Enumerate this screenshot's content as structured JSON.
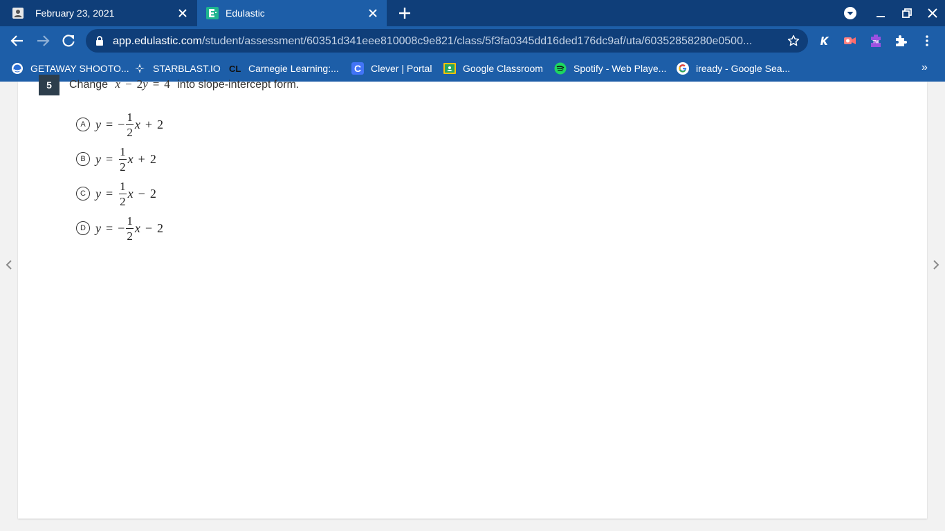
{
  "tabs": [
    {
      "title": "February 23, 2021",
      "active": false,
      "icon": "contacts-icon"
    },
    {
      "title": "Edulastic",
      "active": true,
      "icon": "edulastic-logo-icon"
    }
  ],
  "address_bar": {
    "host": "app.edulastic.com",
    "path": "/student/assessment/60351d341eee810008c9e821/class/5f3fa0345dd16ded176dc9af/uta/60352858280e0500..."
  },
  "bookmarks": [
    {
      "label": "GETAWAY SHOOTO...",
      "icon": "globe-icon"
    },
    {
      "label": "STARBLAST.IO",
      "icon": "starblast-icon"
    },
    {
      "label": "Carnegie Learning:...",
      "icon": "carnegie-learning-icon"
    },
    {
      "label": "Clever | Portal",
      "icon": "clever-icon"
    },
    {
      "label": "Google Classroom",
      "icon": "google-classroom-icon"
    },
    {
      "label": "Spotify - Web Playe...",
      "icon": "spotify-icon"
    },
    {
      "label": "iready - Google Sea...",
      "icon": "google-icon"
    }
  ],
  "bookmarks_more": "»",
  "question": {
    "number": "5",
    "prefix": "Change",
    "suffix": "into slope-intercept form.",
    "equation": {
      "a": "x",
      "op1": "−",
      "b": "2",
      "c": "y",
      "eq": "=",
      "d": "4"
    }
  },
  "choices": [
    {
      "letter": "A",
      "y": "y",
      "eq": "=",
      "sign": "−",
      "num": "1",
      "den": "2",
      "x": "x",
      "op": "+",
      "k": "2"
    },
    {
      "letter": "B",
      "y": "y",
      "eq": "=",
      "sign": "",
      "num": "1",
      "den": "2",
      "x": "x",
      "op": "+",
      "k": "2"
    },
    {
      "letter": "C",
      "y": "y",
      "eq": "=",
      "sign": "",
      "num": "1",
      "den": "2",
      "x": "x",
      "op": "−",
      "k": "2"
    },
    {
      "letter": "D",
      "y": "y",
      "eq": "=",
      "sign": "−",
      "num": "1",
      "den": "2",
      "x": "x",
      "op": "−",
      "k": "2"
    }
  ],
  "colors": {
    "tabstrip": "#0f3e79",
    "toolbar": "#1d5ea8",
    "question_badge": "#2d3e4c"
  }
}
